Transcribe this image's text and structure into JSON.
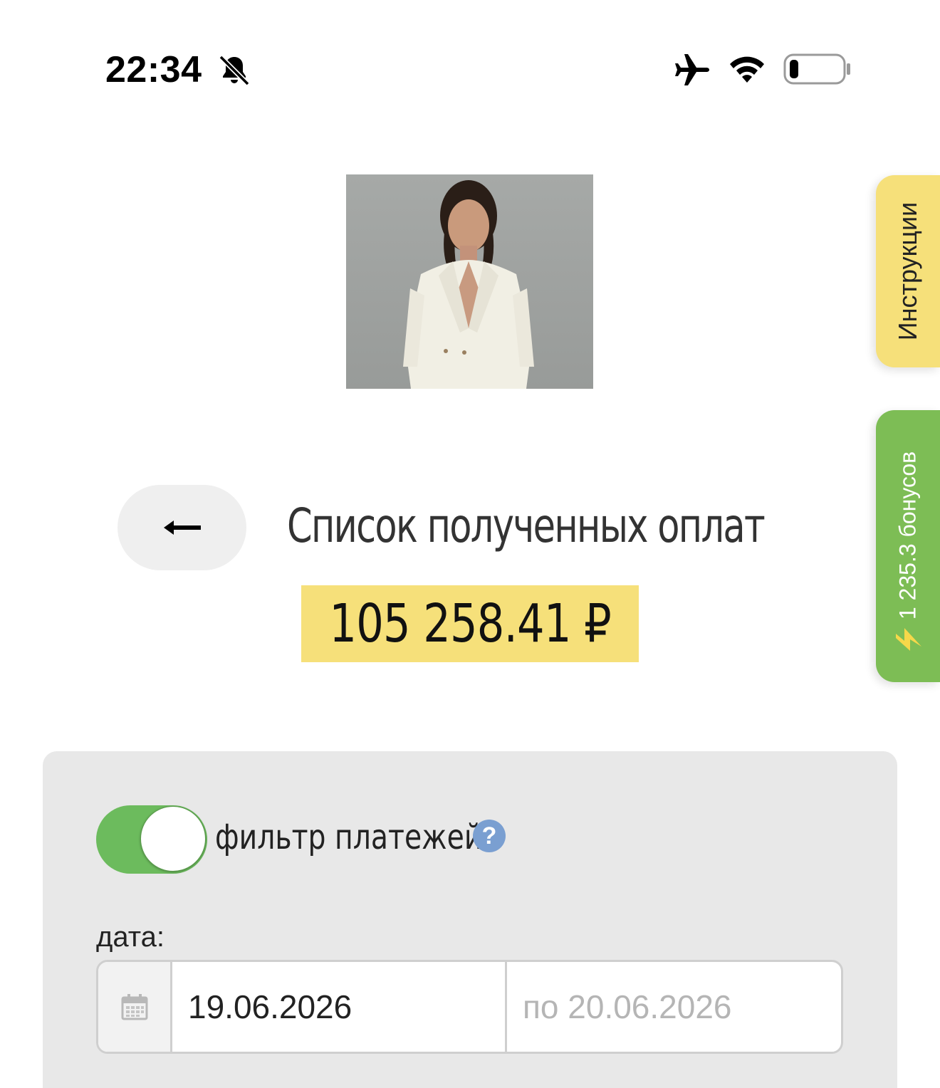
{
  "status_bar": {
    "time": "22:34",
    "icons": [
      "bell-off-icon",
      "airplane-icon",
      "wifi-icon",
      "battery-icon"
    ],
    "battery_level": 0.12
  },
  "side_tabs": {
    "instructions_label": "Инструкции",
    "bonus_label": "1 235.3 бонусов",
    "bonus_icon": "lightning-icon"
  },
  "header": {
    "back_icon": "arrow-left-icon",
    "title": "Список полученных оплат",
    "amount": "105 258.41 ₽"
  },
  "filter": {
    "toggle_on": true,
    "label": "фильтр платежей",
    "help_symbol": "?",
    "date_label": "дата:",
    "date_from_value": "19.06.2026",
    "date_to_placeholder": "по 20.06.2026"
  },
  "colors": {
    "yellow_accent": "#f6e07a",
    "green_accent": "#7dbd55",
    "toggle_green": "#6cbb5d",
    "panel_bg": "#e8e8e8",
    "help_blue": "#7a9fd1"
  }
}
